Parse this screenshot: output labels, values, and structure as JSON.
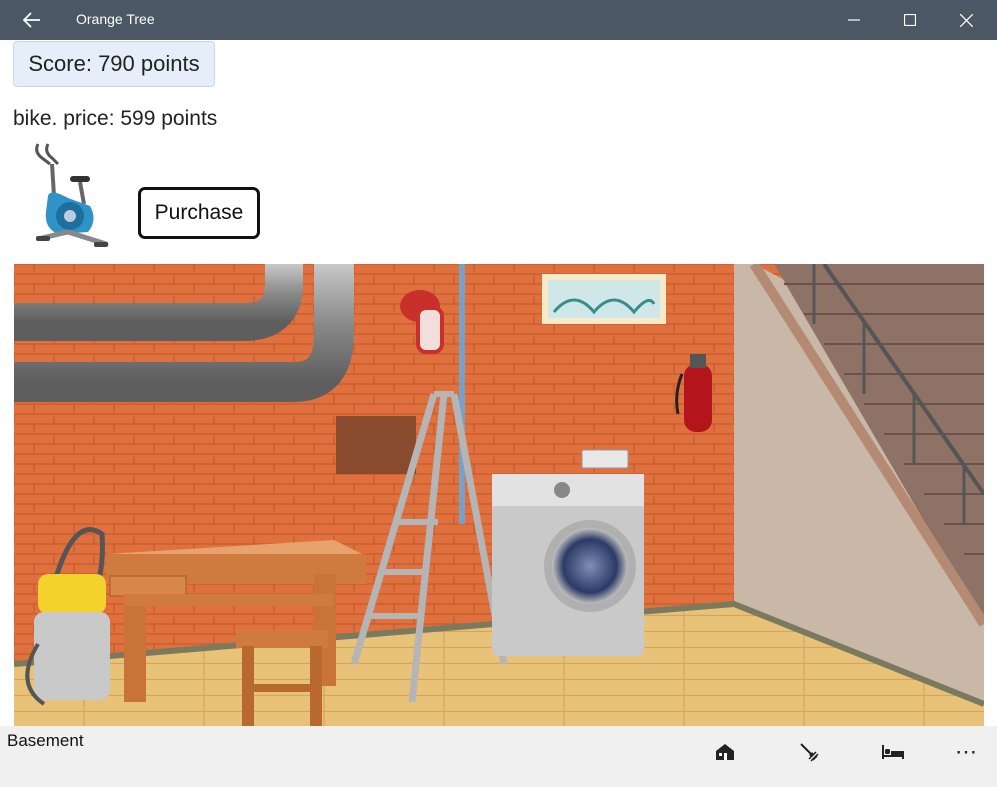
{
  "window": {
    "title": "Orange Tree"
  },
  "score": {
    "label": "Score: 790 points"
  },
  "item": {
    "price_text": "bike. price: 599 points",
    "icon": "exercise-bike-icon"
  },
  "actions": {
    "purchase_label": "Purchase"
  },
  "scene": {
    "name": "basement-scene",
    "wall_color": "#e0713f",
    "floor_color": "#e9c27a"
  },
  "appbar": {
    "page_label": "Basement",
    "buttons": [
      "house-icon",
      "rake-icon",
      "bed-icon"
    ],
    "more": "⋯"
  },
  "colors": {
    "titlebar": "#4c5765",
    "score_bg": "#e6eef9",
    "appbar_bg": "#f0f0f0"
  }
}
